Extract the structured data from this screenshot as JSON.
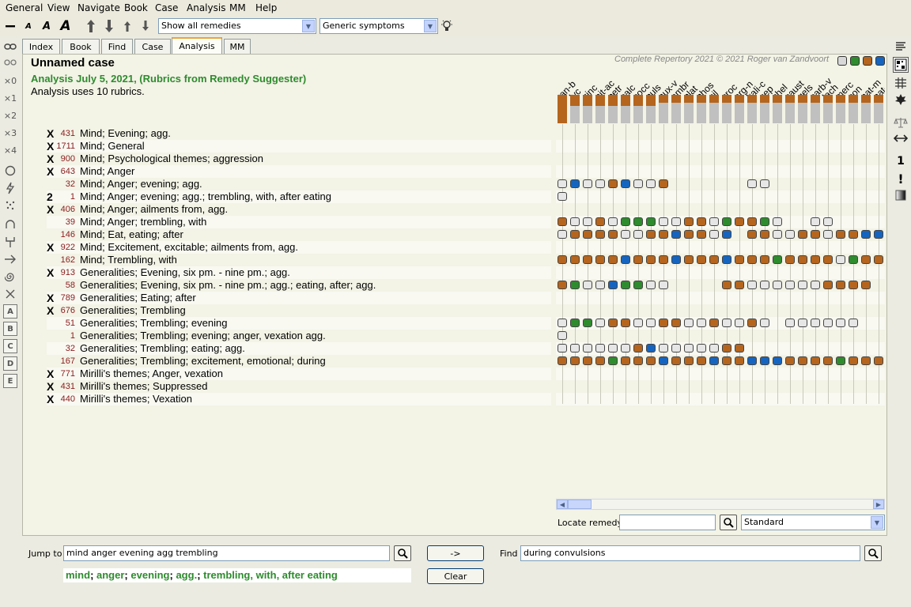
{
  "menu": [
    "General",
    "View",
    "Navigate",
    "Book",
    "Case",
    "Analysis",
    "MM",
    "Help"
  ],
  "toolbar": {
    "font_buttons": [
      "A",
      "A",
      "A"
    ],
    "remedy_filter": "Show all remedies",
    "symptom_filter": "Generic symptoms"
  },
  "lefttools": {
    "labels": [
      "×0",
      "×1",
      "×2",
      "×3",
      "×4"
    ],
    "letters": [
      "A",
      "B",
      "C",
      "D",
      "E"
    ]
  },
  "righttools": {
    "one": "1",
    "excl": "!"
  },
  "tabs": [
    "Index",
    "Book",
    "Find",
    "Case",
    "Analysis",
    "MM"
  ],
  "active_tab": "Analysis",
  "case": {
    "title": "Unnamed case",
    "analysis_title": "Analysis July 5, 2021, (Rubrics from Remedy Suggester)",
    "uses": "Analysis uses 10 rubrics.",
    "copyright": "Complete Repertory 2021 © 2021 Roger van Zandvoort"
  },
  "filter_colors": [
    "#d8d8d8",
    "#2e8b2e",
    "#b5651d",
    "#1565c0"
  ],
  "rubrics": [
    {
      "x": "X",
      "count": "431",
      "label": "Mind; Evening; agg."
    },
    {
      "x": "X",
      "count": "1711",
      "label": "Mind; General"
    },
    {
      "x": "X",
      "count": "900",
      "label": "Mind; Psychological themes; aggression"
    },
    {
      "x": "X",
      "count": "643",
      "label": "Mind; Anger"
    },
    {
      "x": "",
      "count": "32",
      "label": "Mind; Anger; evening; agg."
    },
    {
      "x": "2",
      "count": "1",
      "label": "Mind; Anger; evening; agg.; trembling, with, after eating"
    },
    {
      "x": "X",
      "count": "406",
      "label": "Mind; Anger; ailments from, agg."
    },
    {
      "x": "",
      "count": "39",
      "label": "Mind; Anger; trembling, with"
    },
    {
      "x": "",
      "count": "146",
      "label": "Mind; Eat, eating; after"
    },
    {
      "x": "X",
      "count": "922",
      "label": "Mind; Excitement, excitable; ailments from, agg."
    },
    {
      "x": "",
      "count": "162",
      "label": "Mind; Trembling, with"
    },
    {
      "x": "X",
      "count": "913",
      "label": "Generalities; Evening, six pm. - nine pm.; agg."
    },
    {
      "x": "",
      "count": "58",
      "label": "Generalities; Evening, six pm. - nine pm.; agg.; eating, after; agg."
    },
    {
      "x": "X",
      "count": "789",
      "label": "Generalities; Eating; after"
    },
    {
      "x": "X",
      "count": "676",
      "label": "Generalities; Trembling"
    },
    {
      "x": "",
      "count": "51",
      "label": "Generalities; Trembling; evening"
    },
    {
      "x": "",
      "count": "1",
      "label": "Generalities; Trembling; evening; anger, vexation agg."
    },
    {
      "x": "",
      "count": "32",
      "label": "Generalities; Trembling; eating; agg."
    },
    {
      "x": "",
      "count": "167",
      "label": "Generalities; Trembling; excitement, emotional; during"
    },
    {
      "x": "X",
      "count": "771",
      "label": "Mirilli's themes; Anger, vexation"
    },
    {
      "x": "X",
      "count": "431",
      "label": "Mirilli's themes; Suppressed"
    },
    {
      "x": "X",
      "count": "440",
      "label": "Mirilli's themes; Vexation"
    }
  ],
  "remedies": [
    "ran-b",
    "lyc",
    "zinc",
    "nit-ac",
    "petr",
    "calc",
    "cocc",
    "puls",
    "nux-v",
    "ambr",
    "plat",
    "phos",
    "sil",
    "croc",
    "arg-n",
    "kali-c",
    "sep",
    "chel",
    "caust",
    "gels",
    "carb-v",
    "lach",
    "merc",
    "con",
    "nat-m",
    "nat-"
  ],
  "grid": {
    "4": "gbggobggo......gg",
    "5": "g",
    "7": "oggogaaaggoogaooag..gg.",
    "8": "gooooggooboogb.ooggoogoobboo",
    "10": "oooooboooboooboooaoooogaoooobo",
    "12": "oaggbaagg....ooggggggoooo.gg",
    "15": "gaagooggooggoggog.gggggg",
    "16": "g",
    "17": "ggggggobgggggoo",
    "18": "ooooaoooboooboobbbooooaoooo"
  },
  "locate": {
    "label": "Locate remedy",
    "value": "",
    "mode": "Standard"
  },
  "jump": {
    "label": "Jump to",
    "value": "mind anger evening agg trembling",
    "result_parts": [
      "mind",
      "anger",
      "evening",
      "agg.",
      "trembling, with, after eating"
    ],
    "go": "->",
    "clear": "Clear"
  },
  "find": {
    "label": "Find",
    "value": "during convulsions"
  }
}
